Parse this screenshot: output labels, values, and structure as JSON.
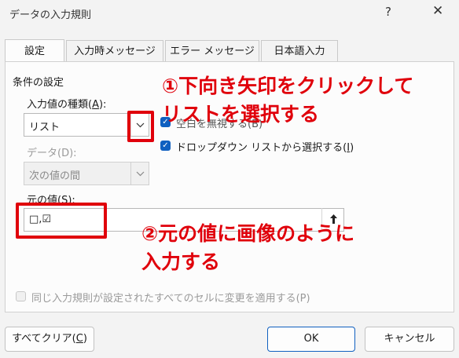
{
  "window": {
    "title": "データの入力規則",
    "help": "?",
    "close": "✕"
  },
  "tabs": [
    {
      "label": "設定",
      "active": true
    },
    {
      "label": "入力時メッセージ",
      "active": false
    },
    {
      "label": "エラー メッセージ",
      "active": false
    },
    {
      "label": "日本語入力",
      "active": false
    }
  ],
  "settings": {
    "group_label": "条件の設定",
    "allow_label_prefix": "入力値の種類(",
    "allow_label_key": "A",
    "allow_label_suffix": "):",
    "allow_value": "リスト",
    "ignore_blank_label": "空白を無視する(B)",
    "dropdown_label_prefix": "ドロップダウン リストから選択する(",
    "dropdown_label_key": "I",
    "dropdown_label_suffix": ")",
    "data_label": "データ(D):",
    "data_value": "次の値の間",
    "source_label_prefix": "元の値(",
    "source_label_key": "S",
    "source_label_suffix": "):",
    "source_value": "□,☑",
    "apply_all_label": "同じ入力規則が設定されたすべてのセルに変更を適用する(P)"
  },
  "buttons": {
    "clear_all_prefix": "すべてクリア(",
    "clear_all_key": "C",
    "clear_all_suffix": ")",
    "ok": "OK",
    "cancel": "キャンセル"
  },
  "annotations": {
    "step1_line1": "①下向き矢印をクリックして",
    "step1_line2": "リストを選択する",
    "step2_line1": "②元の値に画像のように",
    "step2_line2": "入力する"
  },
  "colors": {
    "annotation_red": "#e0000b",
    "accent": "#1060c0"
  }
}
